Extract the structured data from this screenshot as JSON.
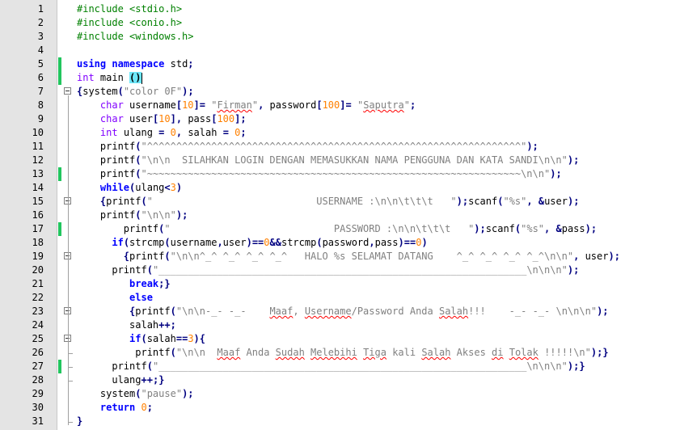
{
  "editor": {
    "line_numbers": [
      "1",
      "2",
      "3",
      "4",
      "5",
      "6",
      "7",
      "8",
      "9",
      "10",
      "11",
      "12",
      "13",
      "14",
      "15",
      "16",
      "17",
      "18",
      "19",
      "20",
      "21",
      "22",
      "23",
      "24",
      "25",
      "26",
      "27",
      "28",
      "29",
      "30",
      "31"
    ],
    "lines": [
      "#include <stdio.h>",
      "#include <conio.h>",
      "#include <windows.h>",
      "",
      "using namespace std;",
      "int main ()",
      "{system(\"color 0F\");",
      "    char username[10]= \"Firman\", password[100]= \"Saputra\";",
      "    char user[10], pass[100];",
      "    int ulang = 0, salah = 0;",
      "    printf(\"^^^^^^^^^^^^^^^^^^^^^^^^^^^^^^^^^^^^^^^^^^^^^^^^^^^^^^^^^^^^^^^^\");",
      "    printf(\"\\n\\n  SILAHKAN LOGIN DENGAN MEMASUKKAN NAMA PENGGUNA DAN KATA SANDI\\n\\n\");",
      "    printf(\"~~~~~~~~~~~~~~~~~~~~~~~~~~~~~~~~~~~~~~~~~~~~~~~~~~~~~~~~~~~~~~~~\\n\\n\");",
      "    while(ulang<3)",
      "    {printf(\"                            USERNAME :\\n\\n\\t\\t\\t   \");scanf(\"%s\", &user);",
      "    printf(\"\\n\\n\");",
      "        printf(\"                            PASSWORD :\\n\\n\\t\\t\\t   \");scanf(\"%s\", &pass);",
      "      if(strcmp(username,user)==0&&strcmp(password,pass)==0)",
      "        {printf(\"\\n\\n^_^ ^_^ ^_^ ^_^   HALO %s SELAMAT DATANG    ^_^ ^_^ ^_^ ^_^\\n\\n\", user);",
      "      printf(\"_______________________________________________________________\\n\\n\\n\");",
      "         break;}",
      "         else",
      "         {printf(\"\\n\\n-_- -_-    Maaf, Username/Password Anda Salah!!!    -_- -_- \\n\\n\\n\");",
      "         salah++;",
      "         if(salah==3){",
      "          printf(\"\\n\\n  Maaf Anda Sudah Melebihi Tiga kali Salah Akses di Tolak !!!!!\\n\");}",
      "      printf(\"_______________________________________________________________\\n\\n\\n\");}",
      "      ulang++;}",
      "    system(\"pause\");",
      "    return 0;",
      "}"
    ]
  },
  "colors": {
    "keyword": "#0000ff",
    "type": "#8000ff",
    "preprocessor": "#008000",
    "string": "#808080",
    "number": "#ff8000",
    "operator": "#000080",
    "change_marker": "#22c55e",
    "brace_highlight": "#6ee7f9",
    "gutter_bg": "#e4e4e4"
  },
  "icons": [
    "fold-minus-icon",
    "change-marker"
  ]
}
